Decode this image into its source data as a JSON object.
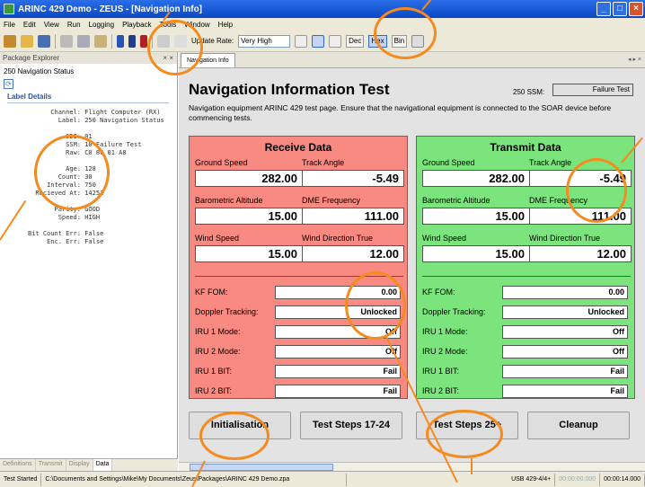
{
  "window": {
    "title": "ARINC 429 Demo - ZEUS - [Navigation Info]"
  },
  "menu": [
    "File",
    "Edit",
    "View",
    "Run",
    "Logging",
    "Playback",
    "Tools",
    "Window",
    "Help"
  ],
  "toolbar": {
    "update_rate_label": "Update Rate:",
    "update_rate_value": "Very High",
    "radix": [
      "Dec",
      "Hex",
      "Bin"
    ],
    "radix_active": "Hex"
  },
  "package_explorer": {
    "header": "Package Explorer",
    "subtitle": "250 Navigation Status",
    "label_details_title": "Label Details",
    "lines": [
      {
        "k": "Channel:",
        "v": "Flight Computer (RX)"
      },
      {
        "k": "Label:",
        "v": "250 Navigation Status"
      },
      {
        "k": "",
        "v": ""
      },
      {
        "k": "SDI:",
        "v": "01"
      },
      {
        "k": "SSM:",
        "v": "10 Failure Test"
      },
      {
        "k": "Raw:",
        "v": "C0 86 01 A8"
      },
      {
        "k": "",
        "v": ""
      },
      {
        "k": "Age:",
        "v": "128"
      },
      {
        "k": "Count:",
        "v": "30"
      },
      {
        "k": "Interval:",
        "v": "750"
      },
      {
        "k": "Recieved At:",
        "v": "14251"
      },
      {
        "k": "",
        "v": ""
      },
      {
        "k": "Parity:",
        "v": "GOOD"
      },
      {
        "k": "Speed:",
        "v": "HIGH"
      },
      {
        "k": "",
        "v": ""
      },
      {
        "k": "Bit Count Err:",
        "v": "False"
      },
      {
        "k": "Enc. Err:",
        "v": "False"
      }
    ],
    "bottom_tabs": [
      "Definitions",
      "Transmit",
      "Display",
      "Data"
    ]
  },
  "doc_tab": "Navigation Info",
  "nav": {
    "title": "Navigation Information Test",
    "ssm_label": "250 SSM:",
    "ssm_value": "Failure Test",
    "description": "Navigation equipment ARINC 429 test page. Ensure that the navigational equipment is connected to the SOAR device before commencing tests."
  },
  "receive": {
    "title": "Receive Data",
    "ground_speed_label": "Ground Speed",
    "ground_speed": "282.00",
    "track_angle_label": "Track Angle",
    "track_angle": "-5.49",
    "baro_alt_label": "Barometric Altitude",
    "baro_alt": "15.00",
    "dme_label": "DME Frequency",
    "dme": "111.00",
    "wind_speed_label": "Wind Speed",
    "wind_speed": "15.00",
    "wind_dir_label": "Wind Direction True",
    "wind_dir": "12.00",
    "kf_fom_label": "KF FOM:",
    "kf_fom": "0.00",
    "doppler_label": "Doppler Tracking:",
    "doppler": "Unlocked",
    "iru1_mode_label": "IRU 1 Mode:",
    "iru1_mode": "Off",
    "iru2_mode_label": "IRU 2 Mode:",
    "iru2_mode": "Off",
    "iru1_bit_label": "IRU 1 BIT:",
    "iru1_bit": "Fail",
    "iru2_bit_label": "IRU 2 BIT:",
    "iru2_bit": "Fail"
  },
  "transmit": {
    "title": "Transmit Data",
    "ground_speed_label": "Ground Speed",
    "ground_speed": "282.00",
    "track_angle_label": "Track Angle",
    "track_angle": "-5.49",
    "baro_alt_label": "Barometric Altitude",
    "baro_alt": "15.00",
    "dme_label": "DME Frequency",
    "dme": "111.00",
    "wind_speed_label": "Wind Speed",
    "wind_speed": "15.00",
    "wind_dir_label": "Wind Direction True",
    "wind_dir": "12.00",
    "kf_fom_label": "KF FOM:",
    "kf_fom": "0.00",
    "doppler_label": "Doppler Tracking:",
    "doppler": "Unlocked",
    "iru1_mode_label": "IRU 1 Mode:",
    "iru1_mode": "Off",
    "iru2_mode_label": "IRU 2 Mode:",
    "iru2_mode": "Off",
    "iru1_bit_label": "IRU 1 BIT:",
    "iru1_bit": "Fail",
    "iru2_bit_label": "IRU 2 BIT:",
    "iru2_bit": "Fail"
  },
  "buttons": {
    "init": "Initialisation",
    "steps_17_24": "Test Steps 17-24",
    "steps_25": "Test Steps 25+",
    "cleanup": "Cleanup"
  },
  "status": {
    "state": "Test Started",
    "path": "C:\\Documents and Settings\\Mike\\My Documents\\Zeus\\Packages\\ARINC 429 Demo.zpa",
    "device": "USB 429-4/4+",
    "time_start": "00:00:00:000",
    "time_end": "00:00:14.000"
  },
  "colors": {
    "receive_bg": "#f88a82",
    "transmit_bg": "#7ce47c",
    "highlight": "#f58a1f"
  }
}
